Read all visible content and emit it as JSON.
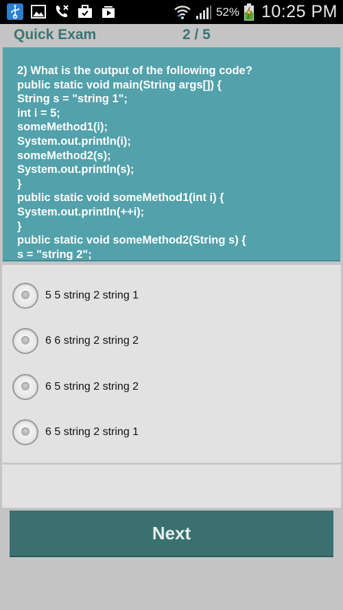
{
  "status_bar": {
    "icons": [
      "usb-icon",
      "image-icon",
      "missed-call-icon",
      "briefcase-icon",
      "media-icon",
      "wifi-icon",
      "signal-icon",
      "battery-charging-icon"
    ],
    "battery_percent": "52%",
    "time": "10:25 PM"
  },
  "header": {
    "app_title": "Quick Exam",
    "progress": "2 / 5"
  },
  "question": {
    "text": "2) What is the output of the following code?\npublic static void main(String args[]) {\nString s = \"string 1\";\nint i = 5;\nsomeMethod1(i);\nSystem.out.println(i);\nsomeMethod2(s);\nSystem.out.println(s);\n}\npublic static void someMethod1(int i) {\nSystem.out.println(++i);\n}\npublic static void someMethod2(String s) {\ns = \"string 2\";"
  },
  "options": [
    {
      "label": "5 5 string 2 string 1",
      "selected": false
    },
    {
      "label": "6 6 string 2 string 2",
      "selected": false
    },
    {
      "label": "6 5 string 2 string 2",
      "selected": false
    },
    {
      "label": "6 5 string 2 string 1",
      "selected": false
    }
  ],
  "next_button": {
    "label": "Next"
  },
  "colors": {
    "accent": "#3a7574",
    "question_bg": "#52a1ab",
    "button_bg": "#3a7070",
    "page_bg": "#c4c4c4",
    "panel_bg": "#e2e2e2"
  }
}
